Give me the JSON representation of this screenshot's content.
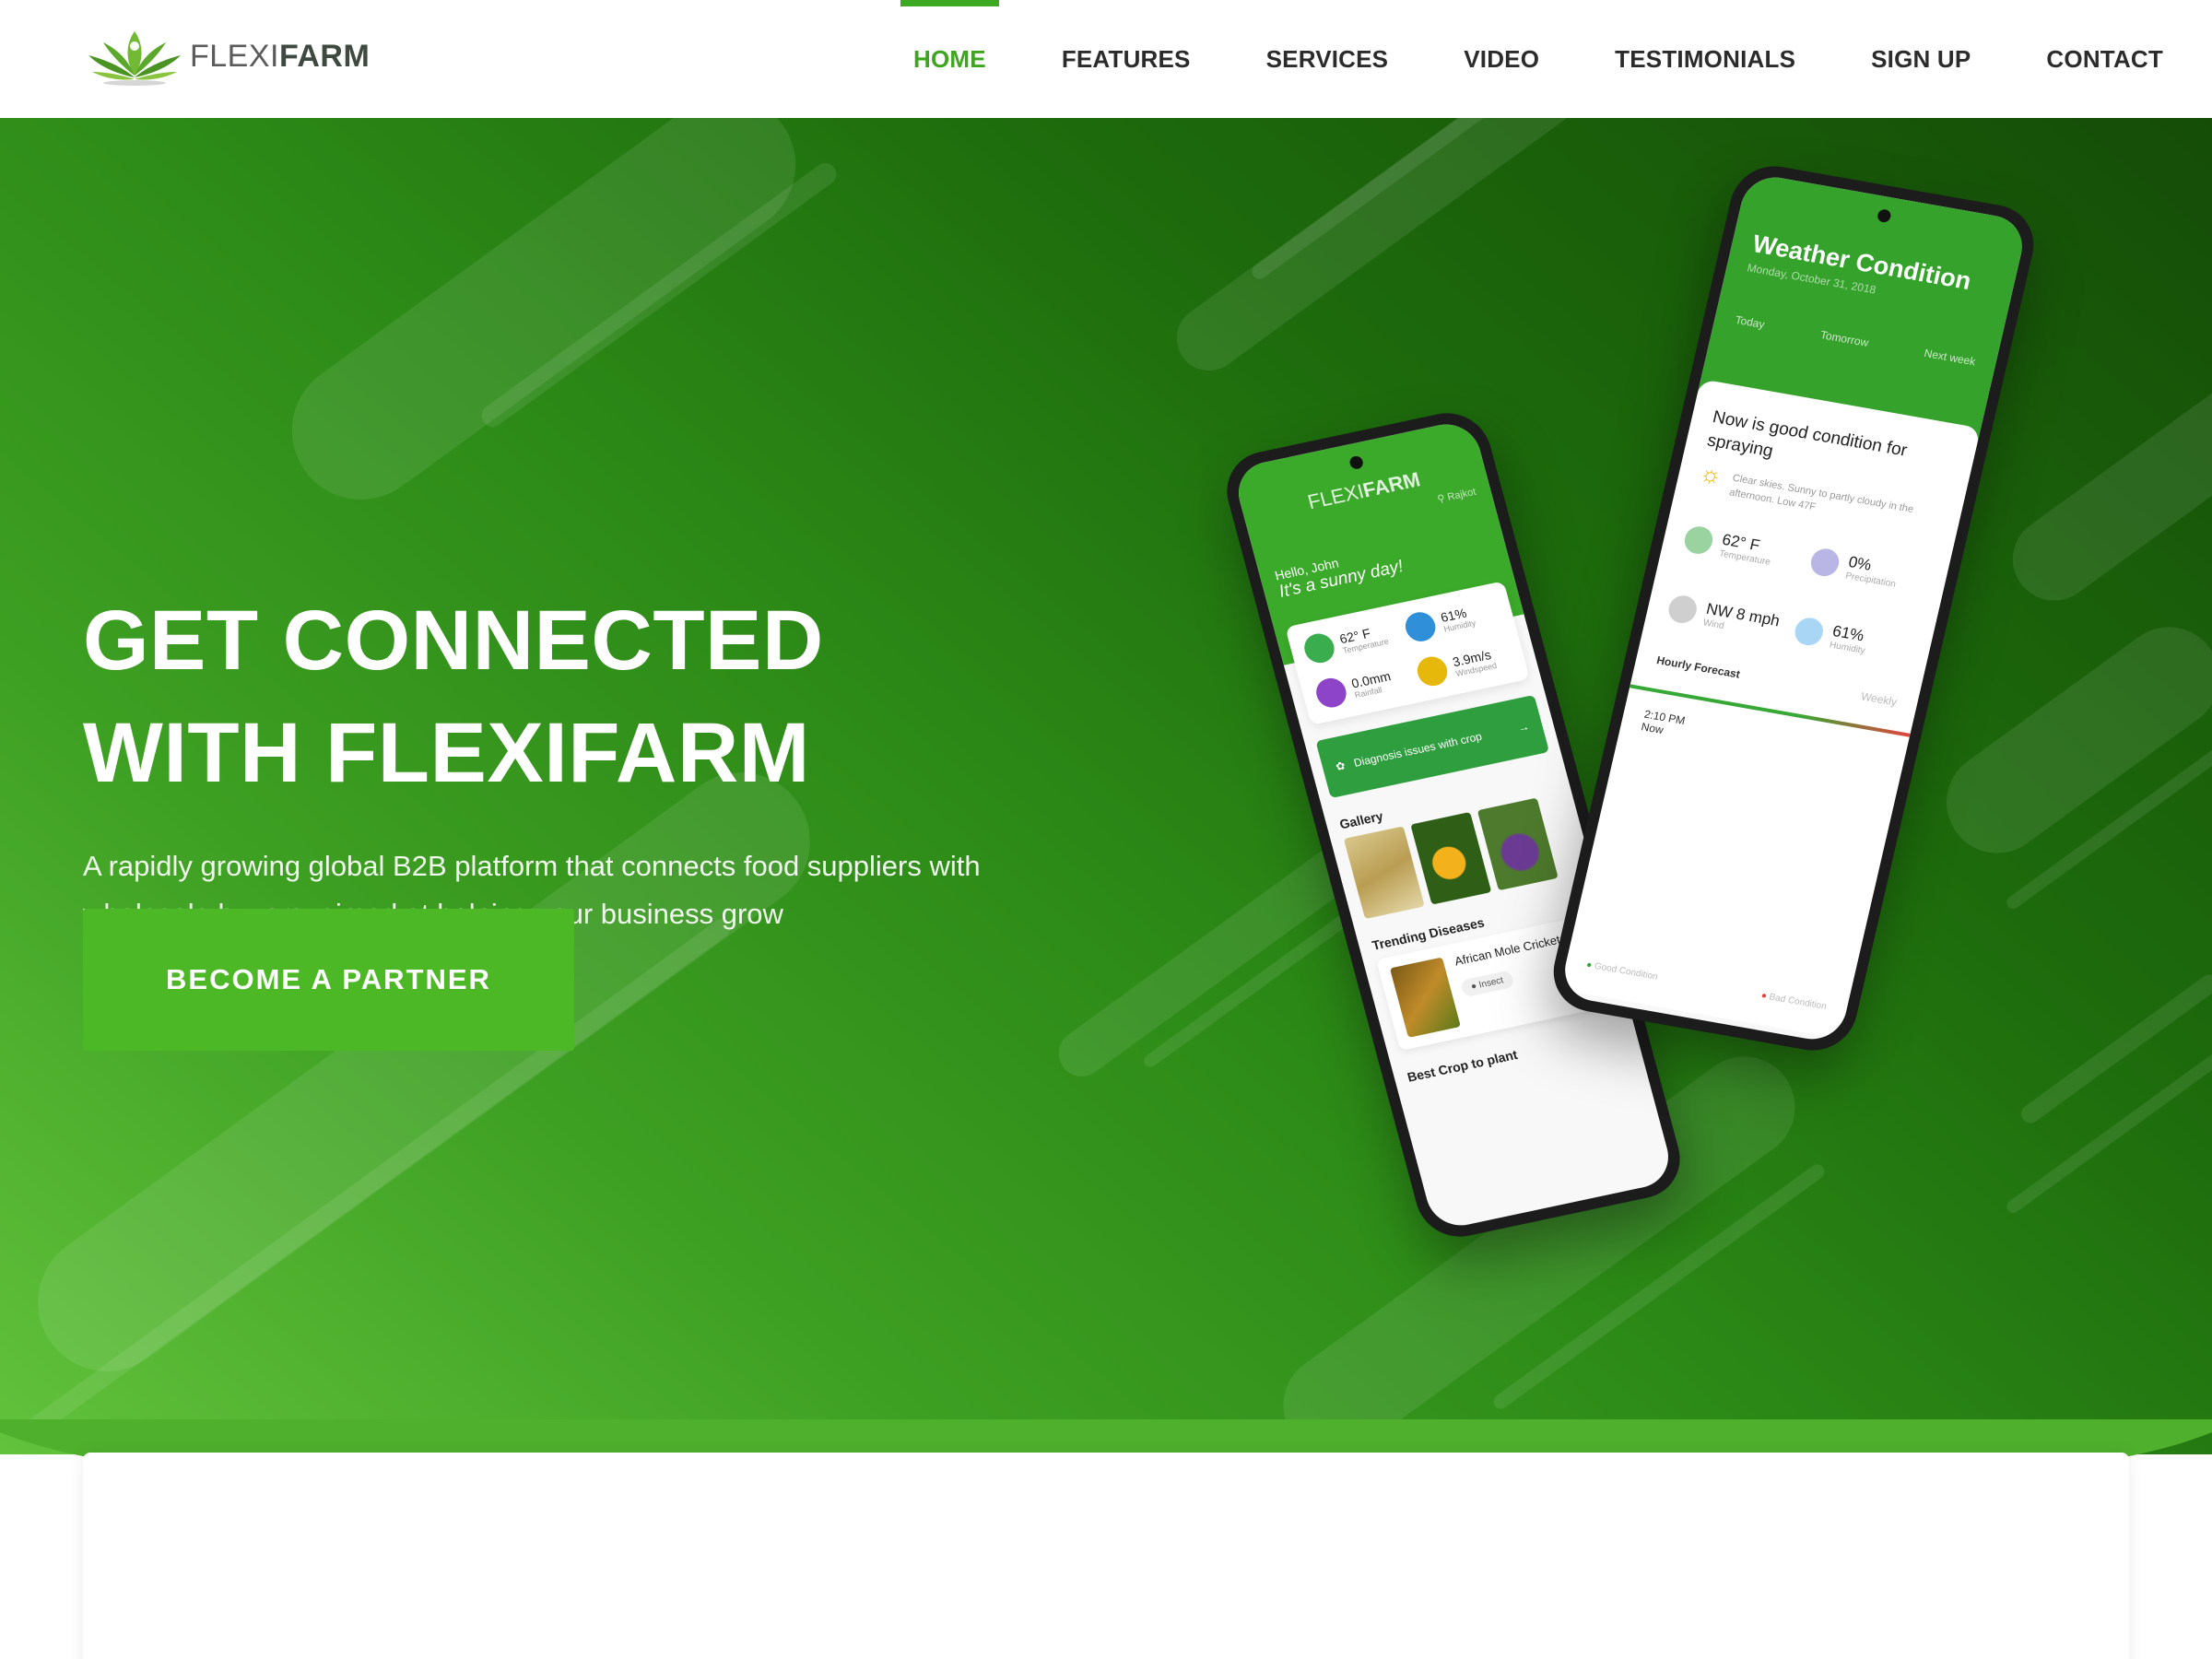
{
  "brand": {
    "light": "FLEXI",
    "bold": "FARM"
  },
  "nav": {
    "items": [
      {
        "label": "HOME",
        "active": true
      },
      {
        "label": "FEATURES",
        "active": false
      },
      {
        "label": "SERVICES",
        "active": false
      },
      {
        "label": "VIDEO",
        "active": false
      },
      {
        "label": "TESTIMONIALS",
        "active": false
      },
      {
        "label": "SIGN UP",
        "active": false
      },
      {
        "label": "CONTACT",
        "active": false
      }
    ]
  },
  "hero": {
    "title_line1": "GET CONNECTED",
    "title_line2": "WITH FLEXIFARM",
    "subtitle_line1": "A rapidly growing global B2B platform that connects food suppliers with",
    "subtitle_line2": "wholesale buyers, aimed at helping your business grow",
    "cta_label": "BECOME A PARTNER"
  },
  "phone_left": {
    "brand_light": "FLEXI",
    "brand_bold": "FARM",
    "location": "Rajkot",
    "greeting": "Hello, John",
    "sunny": "It's a sunny day!",
    "stats": [
      {
        "value": "62° F",
        "label": "Temperature",
        "icon": "thermometer-icon",
        "color": "#3aae4e"
      },
      {
        "value": "61%",
        "label": "Humidity",
        "icon": "droplet-icon",
        "color": "#2f8fd8"
      },
      {
        "value": "0.0mm",
        "label": "Rainfall",
        "icon": "cloud-rain-icon",
        "color": "#8e44c9"
      },
      {
        "value": "3.9m/s",
        "label": "Windspeed",
        "icon": "wind-icon",
        "color": "#e5b80b"
      }
    ],
    "diagnose": "Diagnosis issues with crop",
    "gallery_heading": "Gallery",
    "trending_heading": "Trending Diseases",
    "disease_name": "African Mole Cricket",
    "disease_tag": "Insect",
    "best_crop": "Best Crop to plant"
  },
  "phone_right": {
    "title": "Weather Condition",
    "date": "Monday, October 31, 2018",
    "tabs": [
      "Today",
      "Tomorrow",
      "Next week"
    ],
    "condition": "Now is good condition for spraying",
    "clear": "Clear skies. Sunny to partly cloudy in the afternoon. Low 47F",
    "stats": [
      {
        "value": "62° F",
        "label": "Temperature",
        "icon": "thermometer-icon",
        "color": "#9ad3a0"
      },
      {
        "value": "0%",
        "label": "Precipitation",
        "icon": "umbrella-icon",
        "color": "#b9b6e6"
      },
      {
        "value": "NW 8 mph",
        "label": "Wind",
        "icon": "wind-icon",
        "color": "#cfcfcf"
      },
      {
        "value": "61%",
        "label": "Humidity",
        "icon": "droplet-icon",
        "color": "#a9d6f5"
      }
    ],
    "hourly": "Hourly Forecast",
    "weekly": "Weekly",
    "time": "2:10 PM",
    "now": "Now",
    "legend_good": "Good Condition",
    "legend_bad": "Bad Condition"
  },
  "colors": {
    "accent": "#3ea51f",
    "cta": "#4cb826",
    "hero_dark": "#154d07",
    "hero_light": "#62c23c"
  }
}
